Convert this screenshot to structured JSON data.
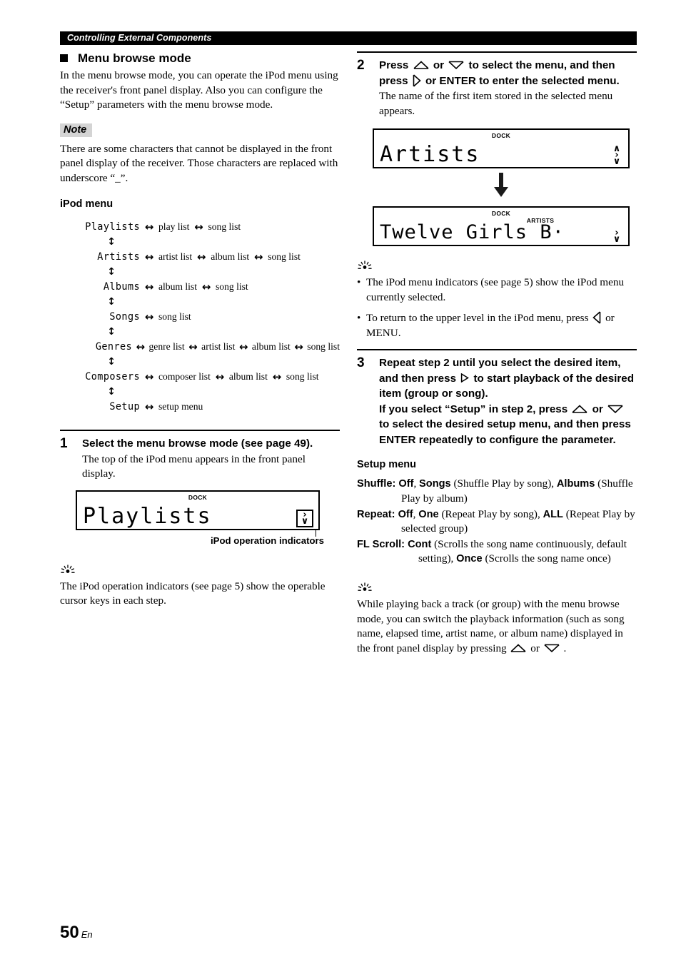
{
  "header": {
    "running_title": "Controlling External Components"
  },
  "left": {
    "section_title": "Menu browse mode",
    "intro": "In the menu browse mode, you can operate the iPod menu using the receiver's front panel display. Also you can configure the “Setup” parameters with the menu browse mode.",
    "note_label": "Note",
    "note_text": "There are some characters that cannot be displayed in the front panel display of the receiver. Those characters are replaced with underscore “_”.",
    "ipod_menu_heading": "iPod menu",
    "tree": [
      {
        "name": "Playlists",
        "items": [
          "play list",
          "song list"
        ]
      },
      {
        "name": "Artists",
        "items": [
          "artist list",
          "album list",
          "song list"
        ]
      },
      {
        "name": "Albums",
        "items": [
          "album list",
          "song list"
        ]
      },
      {
        "name": "Songs",
        "items": [
          "song list"
        ]
      },
      {
        "name": "Genres",
        "items": [
          "genre list",
          "artist list",
          "album list",
          "song list"
        ]
      },
      {
        "name": "Composers",
        "items": [
          "composer list",
          "album list",
          "song list"
        ]
      },
      {
        "name": "Setup",
        "items": [
          "setup menu"
        ]
      }
    ],
    "tree_h_arrow": "↔",
    "tree_v_arrow": "↕",
    "step1": {
      "number": "1",
      "title": "Select the menu browse mode (see page 49).",
      "desc": "The top of the iPod menu appears in the front panel display."
    },
    "lcd_playlists": {
      "dock_label": "DOCK",
      "text": "Playlists",
      "indicators": [
        "›",
        "∨"
      ]
    },
    "callout_label": "iPod operation indicators",
    "tip1": "The iPod operation indicators (see page 5) show the operable cursor keys in each step."
  },
  "right": {
    "step2": {
      "number": "2",
      "title_part1": "Press",
      "title_part2": "or",
      "title_part3": "to select the menu, and then press",
      "title_part4": "or ENTER to enter the selected menu.",
      "desc": "The name of the first item stored in the selected menu appears."
    },
    "lcd_artists": {
      "dock_label": "DOCK",
      "text": "Artists",
      "indicators": [
        "∧",
        "›",
        "∨"
      ]
    },
    "lcd_twelve": {
      "dock_label": "DOCK",
      "mode_label": "ARTISTS",
      "text": "Twelve Girls B·",
      "indicators": [
        "›",
        "∨"
      ]
    },
    "tip2_bullets": [
      "The iPod menu indicators (see page 5) show the iPod menu currently selected.",
      "To return to the upper level in the iPod menu, press"
    ],
    "tip2_bullet2_tail": "or MENU.",
    "step3": {
      "number": "3",
      "title_part1": "Repeat step 2 until you select the desired item, and then press",
      "title_part2": "to start playback of the desired item (group or song).",
      "title_part3": "If you select “Setup” in step 2, press",
      "title_part4": "or",
      "title_part5": "to select the desired setup menu, and then press ENTER repeatedly to configure the parameter."
    },
    "setup_heading": "Setup menu",
    "setup_items": [
      {
        "label": "Shuffle:",
        "parts": [
          {
            "text": "Off",
            "bold": true
          },
          {
            "text": ", ",
            "bold": false
          },
          {
            "text": "Songs",
            "bold": true
          },
          {
            "text": " (Shuffle Play by song), ",
            "bold": false
          },
          {
            "text": "Albums",
            "bold": true
          },
          {
            "text": " (Shuffle Play by album)",
            "bold": false
          }
        ]
      },
      {
        "label": "Repeat:",
        "parts": [
          {
            "text": "Off",
            "bold": true
          },
          {
            "text": ", ",
            "bold": false
          },
          {
            "text": "One",
            "bold": true
          },
          {
            "text": " (Repeat Play by song), ",
            "bold": false
          },
          {
            "text": "ALL",
            "bold": true
          },
          {
            "text": " (Repeat Play by selected group)",
            "bold": false
          }
        ]
      },
      {
        "label": "FL Scroll:",
        "parts": [
          {
            "text": "Cont",
            "bold": true
          },
          {
            "text": " (Scrolls the song name continuously, default setting), ",
            "bold": false
          },
          {
            "text": "Once",
            "bold": true
          },
          {
            "text": " (Scrolls the song name once)",
            "bold": false
          }
        ]
      }
    ],
    "tip3_part1": "While playing back a track (or group) with the menu browse mode, you can switch the playback information (such as song name, elapsed time, artist name, or album name) displayed in the front panel display by pressing",
    "tip3_part2": "or",
    "tip3_part3": "."
  },
  "footer": {
    "page_number": "50",
    "lang": "En"
  }
}
